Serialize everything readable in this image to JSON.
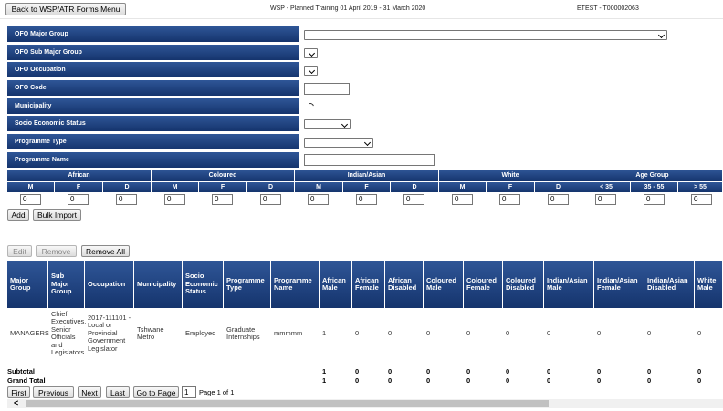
{
  "header": {
    "back_label": "Back to WSP/ATR Forms Menu",
    "title": "WSP - Planned Training 01 April 2019 - 31 March 2020",
    "org": "ETEST - T000002063"
  },
  "form": {
    "ofo_major_group": "OFO Major Group",
    "ofo_sub_major_group": "OFO Sub Major Group",
    "ofo_occupation": "OFO Occupation",
    "ofo_code": "OFO Code",
    "municipality": "Municipality",
    "socio_economic_status": "Socio Economic Status",
    "programme_type": "Programme Type",
    "programme_name": "Programme Name"
  },
  "demographics": {
    "groups": [
      "African",
      "Coloured",
      "Indian/Asian",
      "White",
      "Age Group"
    ],
    "sub": [
      "M",
      "F",
      "D",
      "M",
      "F",
      "D",
      "M",
      "F",
      "D",
      "M",
      "F",
      "D",
      "< 35",
      "35 - 55",
      "> 55"
    ],
    "values": [
      "0",
      "0",
      "0",
      "0",
      "0",
      "0",
      "0",
      "0",
      "0",
      "0",
      "0",
      "0",
      "0",
      "0",
      "0"
    ]
  },
  "actions": {
    "add": "Add",
    "bulk_import": "Bulk Import",
    "edit": "Edit",
    "remove": "Remove",
    "remove_all": "Remove All"
  },
  "table": {
    "columns": [
      "Major Group",
      "Sub Major Group",
      "Occupation",
      "Municipality",
      "Socio Economic Status",
      "Programme Type",
      "Programme Name",
      "African Male",
      "African Female",
      "African Disabled",
      "Coloured Male",
      "Coloured Female",
      "Coloured Disabled",
      "Indian/Asian Male",
      "Indian/Asian Female",
      "Indian/Asian Disabled",
      "White Male"
    ],
    "rows": [
      [
        "MANAGERS",
        "Chief Executives, Senior Officials and Legislators",
        "2017-111101 - Local or Provincial Government Legislator",
        "Tshwane Metro",
        "Employed",
        "Graduate Internships",
        "mmmmm",
        "1",
        "0",
        "0",
        "0",
        "0",
        "0",
        "0",
        "0",
        "0",
        "0"
      ]
    ],
    "subtotal": {
      "label": "Subtotal",
      "values": [
        "1",
        "0",
        "0",
        "0",
        "0",
        "0",
        "0",
        "0",
        "0",
        "0"
      ]
    },
    "grandtotal": {
      "label": "Grand Total",
      "values": [
        "1",
        "0",
        "0",
        "0",
        "0",
        "0",
        "0",
        "0",
        "0",
        "0"
      ]
    }
  },
  "pager": {
    "first": "First",
    "previous": "Previous",
    "next": "Next",
    "last": "Last",
    "goto": "Go to Page",
    "page": "1",
    "page_info": "Page 1 of 1"
  },
  "scroll_left": "<"
}
